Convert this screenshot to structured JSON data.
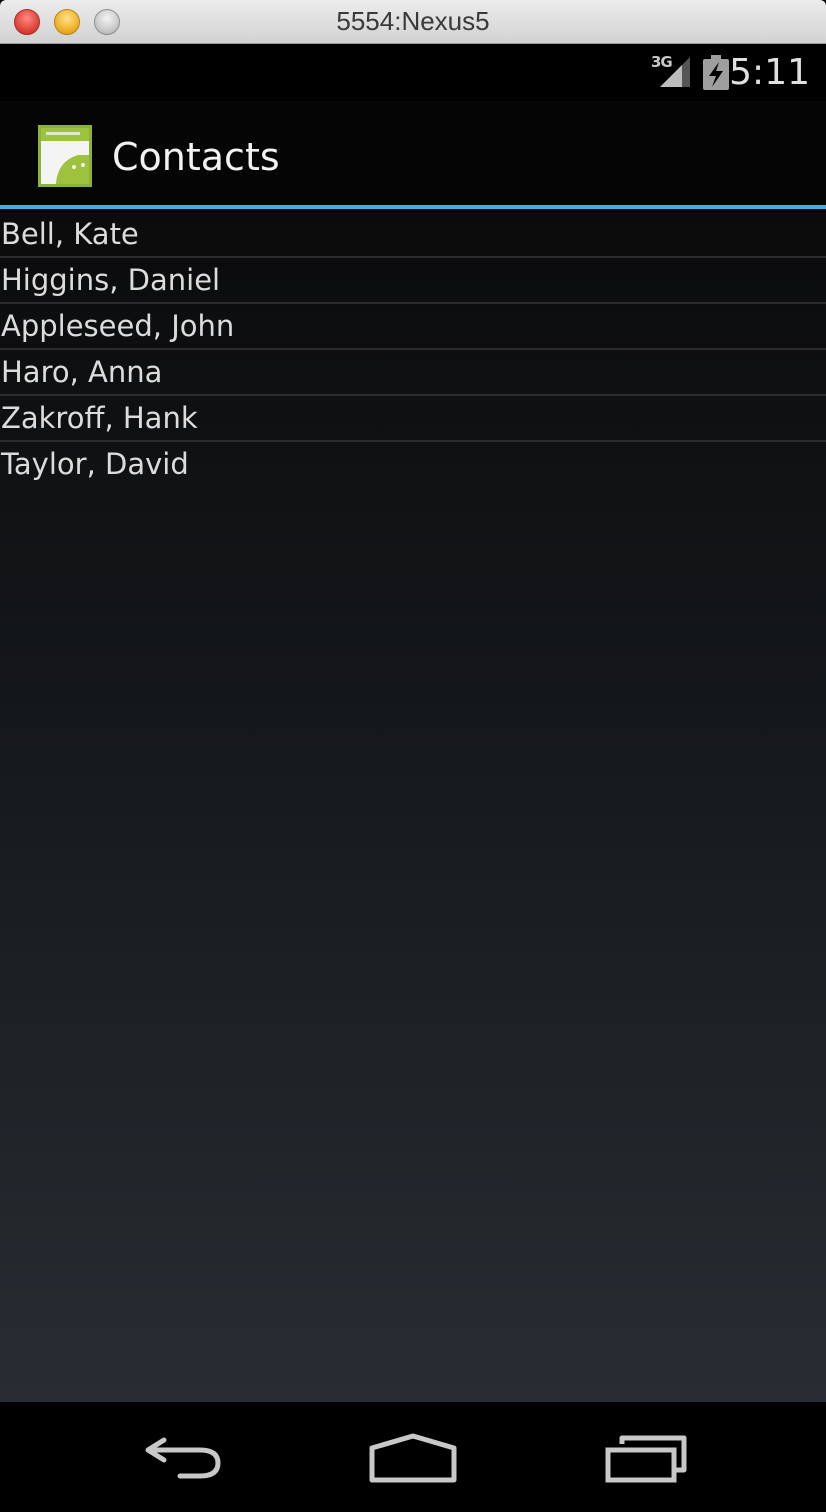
{
  "window": {
    "title": "5554:Nexus5"
  },
  "status_bar": {
    "network_type": "3G",
    "time": "5:11",
    "icons": [
      "signal-icon",
      "battery-charging-icon"
    ]
  },
  "action_bar": {
    "title": "Contacts",
    "icon": "app-launcher-icon",
    "accent_color": "#33b5e5"
  },
  "contacts": [
    "Bell, Kate",
    "Higgins, Daniel",
    "Appleseed, John",
    "Haro, Anna",
    "Zakroff, Hank",
    "Taylor, David"
  ],
  "navigation_bar": {
    "buttons": [
      "back-icon",
      "home-icon",
      "recent-apps-icon"
    ]
  }
}
